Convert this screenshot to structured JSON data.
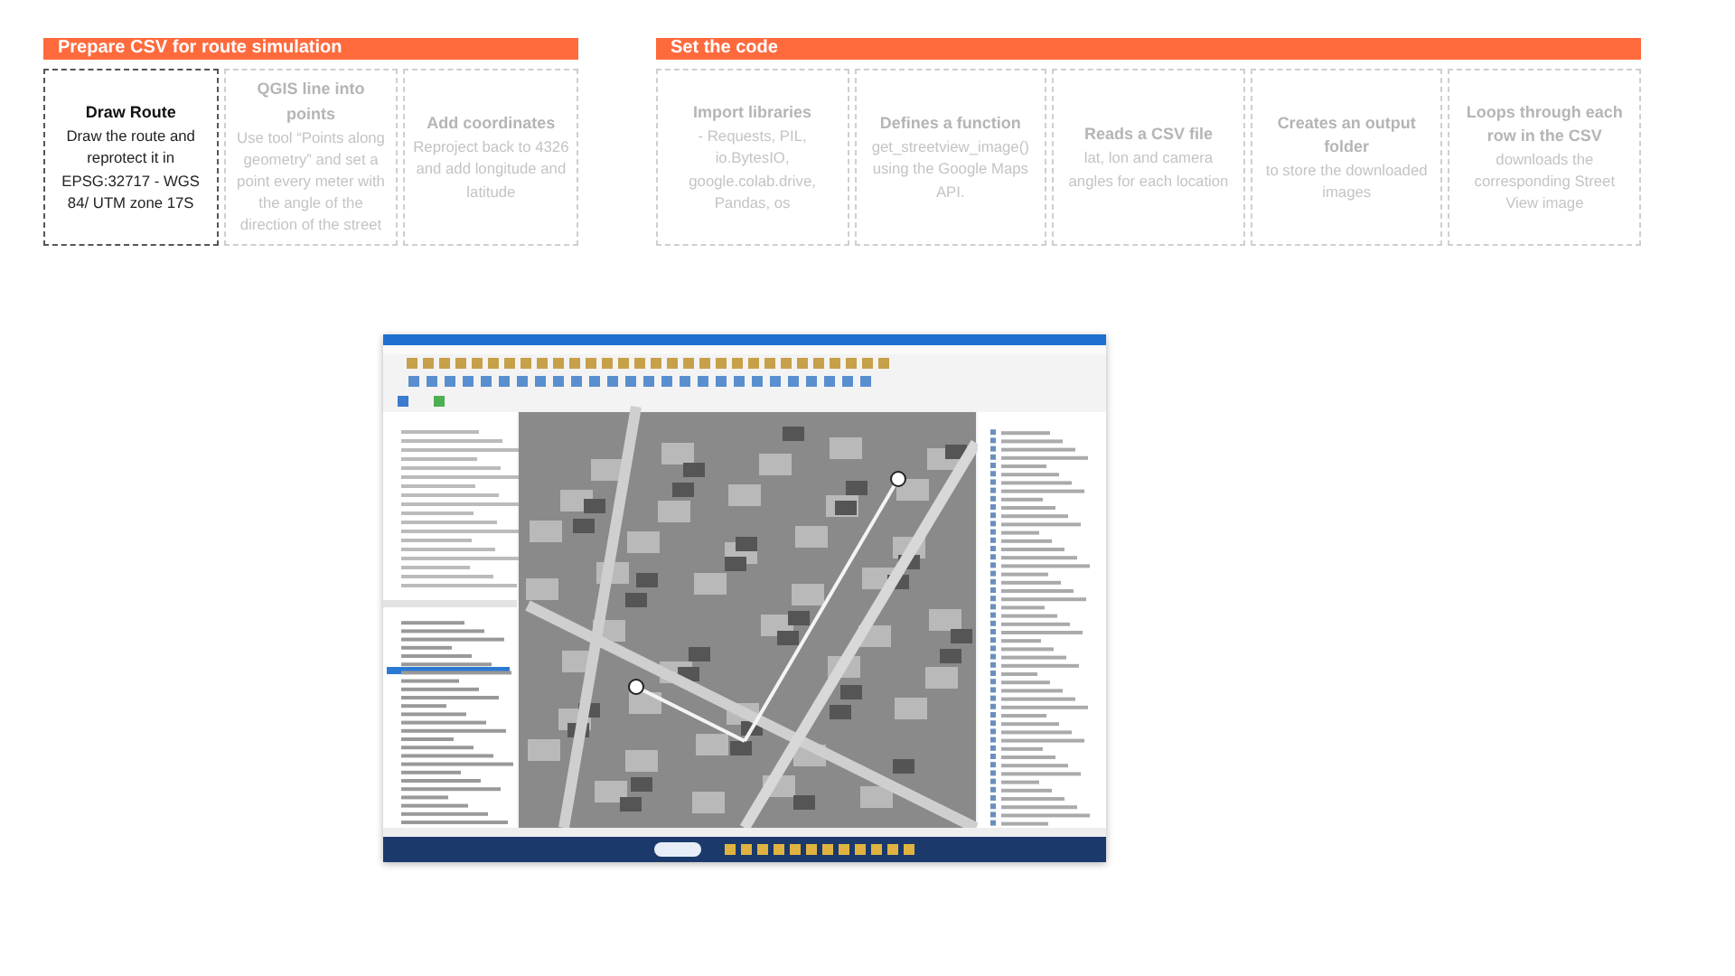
{
  "sections": [
    {
      "title": "Prepare CSV for route simulation",
      "steps": [
        {
          "title": "Draw Route",
          "body": "Draw the route and reprotect it in EPSG:32717 - WGS 84/ UTM zone 17S",
          "active": true
        },
        {
          "title": "QGIS line into points",
          "body": "Use tool “Points along geometry” and set a point every meter with the angle of the direction of the street",
          "active": false
        },
        {
          "title": "Add coordinates",
          "body": "Reproject  back to 4326 and add longitude and latitude",
          "active": false
        }
      ]
    },
    {
      "title": "Set the code",
      "steps": [
        {
          "title": "Import libraries",
          "body": "- Requests, PIL, io.BytesIO, google.colab.drive, Pandas, os",
          "active": false
        },
        {
          "title": "Defines a function",
          "body": "get_streetview_image() using the Google Maps API.",
          "active": false
        },
        {
          "title": "Reads a CSV file",
          "body": "lat, lon and camera angles for each location",
          "active": false
        },
        {
          "title": "Creates an output folder",
          "body": "to store the downloaded images",
          "active": false
        },
        {
          "title": "Loops through each row in the CSV",
          "body": "downloads the corresponding Street View image",
          "active": false
        }
      ]
    }
  ]
}
